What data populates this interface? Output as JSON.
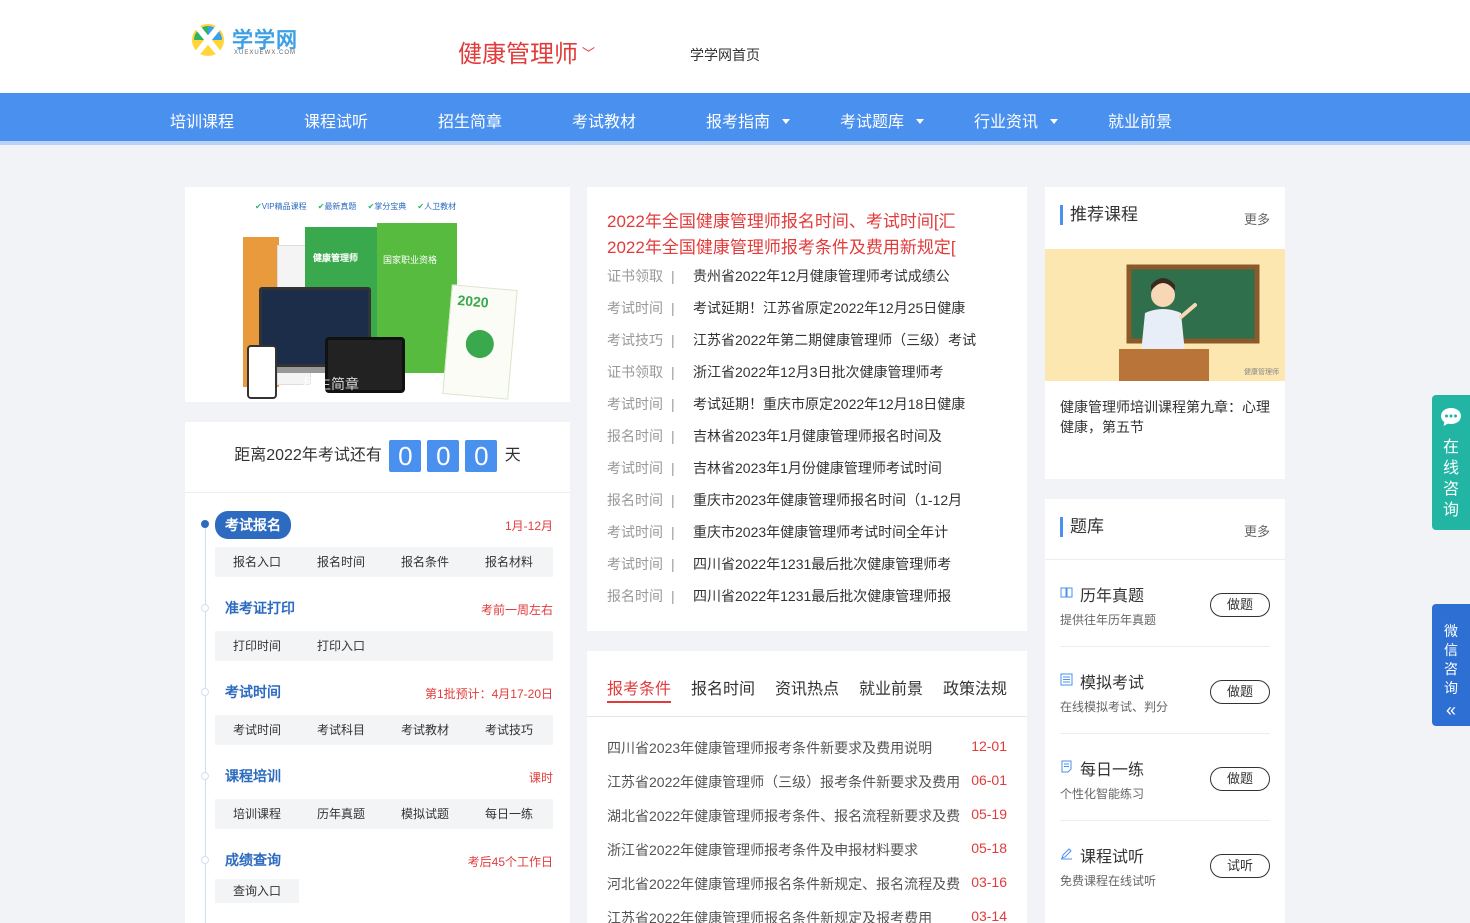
{
  "header": {
    "logo_text": "学学网",
    "logo_sub": "XUEXUEWX.COM",
    "site_title": "健康管理师",
    "home_link": "学学网首页"
  },
  "nav": [
    {
      "label": "培训课程",
      "dropdown": false
    },
    {
      "label": "课程试听",
      "dropdown": false
    },
    {
      "label": "招生简章",
      "dropdown": false
    },
    {
      "label": "考试教材",
      "dropdown": false
    },
    {
      "label": "报考指南",
      "dropdown": true
    },
    {
      "label": "考试题库",
      "dropdown": true
    },
    {
      "label": "行业资讯",
      "dropdown": true
    },
    {
      "label": "就业前景",
      "dropdown": false
    }
  ],
  "banner": {
    "tags": [
      "VIP精品课程",
      "最新真题",
      "掌分宝典",
      "人卫教材"
    ],
    "book_label": "健康管理师",
    "book_sub": "国家职业资格",
    "year": "2020",
    "overlay": "招生简章"
  },
  "countdown": {
    "prefix": "距离2022年考试还有",
    "digits": [
      "0",
      "0",
      "0"
    ],
    "suffix": "天"
  },
  "steps": [
    {
      "title": "考试报名",
      "note": "1月-12月",
      "links": [
        "报名入口",
        "报名时间",
        "报名条件",
        "报名材料"
      ]
    },
    {
      "title": "准考证打印",
      "note": "考前一周左右",
      "links": [
        "打印时间",
        "打印入口"
      ]
    },
    {
      "title": "考试时间",
      "note": "第1批预计：4月17-20日",
      "links": [
        "考试时间",
        "考试科目",
        "考试教材",
        "考试技巧"
      ]
    },
    {
      "title": "课程培训",
      "note": "课时",
      "links": [
        "培训课程",
        "历年真题",
        "模拟试题",
        "每日一练"
      ]
    },
    {
      "title": "成绩查询",
      "note": "考后45个工作日",
      "links": [
        "查询入口"
      ]
    }
  ],
  "news": {
    "headlines": [
      "2022年全国健康管理师报名时间、考试时间[汇",
      "2022年全国健康管理师报考条件及费用新规定["
    ],
    "separator": "|",
    "items": [
      {
        "cat": "证书领取",
        "title": "贵州省2022年12月健康管理师考试成绩公"
      },
      {
        "cat": "考试时间",
        "title": "考试延期！江苏省原定2022年12月25日健康"
      },
      {
        "cat": "考试技巧",
        "title": "江苏省2022年第二期健康管理师（三级）考试"
      },
      {
        "cat": "证书领取",
        "title": "浙江省2022年12月3日批次健康管理师考"
      },
      {
        "cat": "考试时间",
        "title": "考试延期！重庆市原定2022年12月18日健康"
      },
      {
        "cat": "报名时间",
        "title": "吉林省2023年1月健康管理师报名时间及"
      },
      {
        "cat": "考试时间",
        "title": "吉林省2023年1月份健康管理师考试时间"
      },
      {
        "cat": "报名时间",
        "title": "重庆市2023年健康管理师报名时间（1-12月"
      },
      {
        "cat": "考试时间",
        "title": "重庆市2023年健康管理师考试时间全年计"
      },
      {
        "cat": "考试时间",
        "title": "四川省2022年1231最后批次健康管理师考"
      },
      {
        "cat": "报名时间",
        "title": "四川省2022年1231最后批次健康管理师报"
      }
    ]
  },
  "tabs": {
    "labels": [
      "报考条件",
      "报名时间",
      "资讯热点",
      "就业前景",
      "政策法规"
    ],
    "active": 0,
    "items": [
      {
        "title": "四川省2023年健康管理师报考条件新要求及费用说明",
        "date": "12-01"
      },
      {
        "title": "江苏省2022年健康管理师（三级）报考条件新要求及费用",
        "date": "06-01"
      },
      {
        "title": "湖北省2022年健康管理师报考条件、报名流程新要求及费",
        "date": "05-19"
      },
      {
        "title": "浙江省2022年健康管理师报考条件及申报材料要求",
        "date": "05-18"
      },
      {
        "title": "河北省2022年健康管理师报名条件新规定、报名流程及费",
        "date": "03-16"
      },
      {
        "title": "江苏省2022年健康管理师报名条件新规定及报考费用",
        "date": "03-14"
      }
    ]
  },
  "recommend": {
    "title": "推荐课程",
    "more": "更多",
    "caption": "健康管理师培训课程第九章：心理健康，第五节",
    "watermark": "健康管理师"
  },
  "quiz": {
    "title": "题库",
    "more": "更多",
    "items": [
      {
        "name": "历年真题",
        "desc": "提供往年历年真题",
        "button": "做题",
        "icon": "book-icon"
      },
      {
        "name": "模拟考试",
        "desc": "在线模拟考试、判分",
        "button": "做题",
        "icon": "list-icon"
      },
      {
        "name": "每日一练",
        "desc": "个性化智能练习",
        "button": "做题",
        "icon": "note-icon"
      },
      {
        "name": "课程试听",
        "desc": "免费课程在线试听",
        "button": "试听",
        "icon": "pencil-icon"
      }
    ]
  },
  "float": {
    "consult": "在线咨询",
    "wechat": "微信咨询"
  },
  "colors": {
    "accent": "#4a90ee",
    "brand_red": "#e23b3b",
    "step_blue": "#2c6bbf",
    "consult_green": "#22b5a4",
    "wechat_blue": "#2e6fd3"
  }
}
